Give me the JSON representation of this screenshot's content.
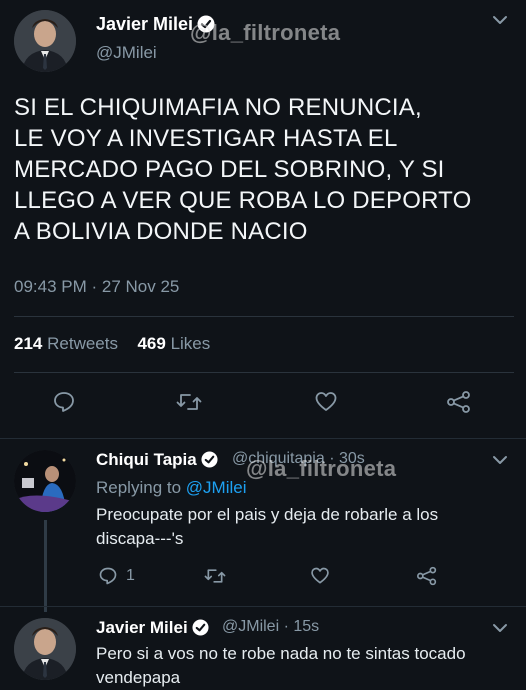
{
  "main_tweet": {
    "author_name": "Javier Milei",
    "author_handle": "@JMilei",
    "watermark": "@la_filtroneta",
    "text": "SI EL CHIQUIMAFIA NO RENUNCIA,\nLE VOY A INVESTIGAR HASTA EL\nMERCADO PAGO DEL SOBRINO, Y SI\nLLEGO A VER QUE ROBA LO DEPORTO\nA BOLIVIA DONDE NACIO",
    "timestamp": "09:43 PM · 27 Nov 25",
    "retweets_count": "214",
    "retweets_label": "Retweets",
    "likes_count": "469",
    "likes_label": "Likes"
  },
  "reply_1": {
    "author_name": "Chiqui Tapia",
    "author_handle": "@chiquitapia · 30s",
    "watermark": "@la_filtroneta",
    "replying_prefix": "Replying to",
    "replying_to": "@JMilei",
    "text": "Preocupate por el pais y deja de robarle a los discapa---'s",
    "reply_count": "1"
  },
  "reply_2": {
    "author_name": "Javier Milei",
    "author_handle": "@JMilei · 15s",
    "text": "Pero si a vos no te robe nada no te sintas tocado vendepapa"
  },
  "colors": {
    "background": "#0f1318",
    "secondary_text": "#8899a6",
    "link": "#1da1f2"
  }
}
